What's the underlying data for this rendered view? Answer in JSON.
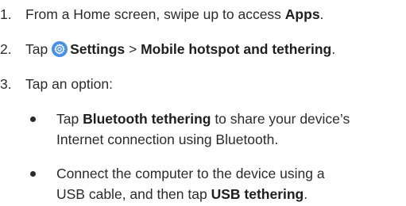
{
  "steps": [
    {
      "num": "1.",
      "pre": "From a Home screen, swipe up to access ",
      "bold": "Apps",
      "post": "."
    },
    {
      "num": "2.",
      "pre": "Tap ",
      "icon": "settings-gear-icon",
      "bold1": "Settings",
      "sep": " > ",
      "bold2": "Mobile hotspot and tethering",
      "post": "."
    },
    {
      "num": "3.",
      "text": "Tap an option:"
    }
  ],
  "bullets": [
    {
      "pre": "Tap ",
      "bold": "Bluetooth tethering",
      "post": " to share your device’s",
      "line2": "Internet connection using Bluetooth."
    },
    {
      "line1": "Connect the computer to the device using a",
      "pre2": "USB cable, and then tap ",
      "bold": "USB tethering",
      "post2": "."
    }
  ],
  "colors": {
    "text": "#2b2b2b",
    "icon_accent": "#4a90e2"
  }
}
